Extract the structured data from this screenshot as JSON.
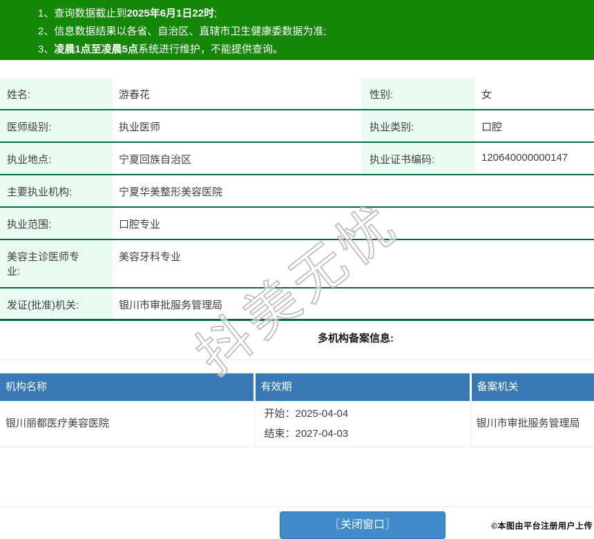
{
  "banner": {
    "notices": [
      {
        "prefix": "1、查询数据截止到",
        "bold": "2025年6月1日22时",
        "suffix": ";"
      },
      {
        "prefix": "2、信息数据结果以各省、自治区、直辖市卫生健康委数据为准;",
        "bold": "",
        "suffix": ""
      },
      {
        "prefix": "3、",
        "bold": "凌晨1点至凌晨5点",
        "suffix": "系统进行维护，不能提供查询。"
      }
    ]
  },
  "info": {
    "rows": [
      {
        "label": "姓名:",
        "value": "游春花",
        "label2": "性别:",
        "value2": "女"
      },
      {
        "label": "医师级别:",
        "value": "执业医师",
        "label2": "执业类别:",
        "value2": "口腔"
      },
      {
        "label": "执业地点:",
        "value": "宁夏回族自治区",
        "label2": "执业证书编码:",
        "value2": "120640000000147"
      },
      {
        "label": "主要执业机构:",
        "value": "宁夏华美整形美容医院"
      },
      {
        "label": "执业范围:",
        "value": "口腔专业"
      },
      {
        "label": "美容主诊医师专业:",
        "value": "美容牙科专业"
      },
      {
        "label": "发证(批准)机关:",
        "value": "银川市审批服务管理局"
      }
    ]
  },
  "filing": {
    "title": "多机构备案信息:",
    "table": {
      "headers": [
        "机构名称",
        "有效期",
        "备案机关"
      ],
      "rows": [
        {
          "org": "银川丽都医疗美容医院",
          "valid_start": "开始：2025-04-04",
          "valid_end": "结束：2027-04-03",
          "authority": "银川市审批服务管理局"
        }
      ]
    }
  },
  "watermark": {
    "text": "抖美无忧"
  },
  "footer": {
    "close_button": "〖关闭窗口〗",
    "credit": "©本图由平台注册用户上传"
  },
  "colors": {
    "banner_green": "#148708",
    "row_border_green": "#086940",
    "label_bg_mint": "#eafbf3",
    "table_header_blue": "#3778b5",
    "button_blue": "#418bca",
    "button_border_blue": "#3071a9"
  }
}
